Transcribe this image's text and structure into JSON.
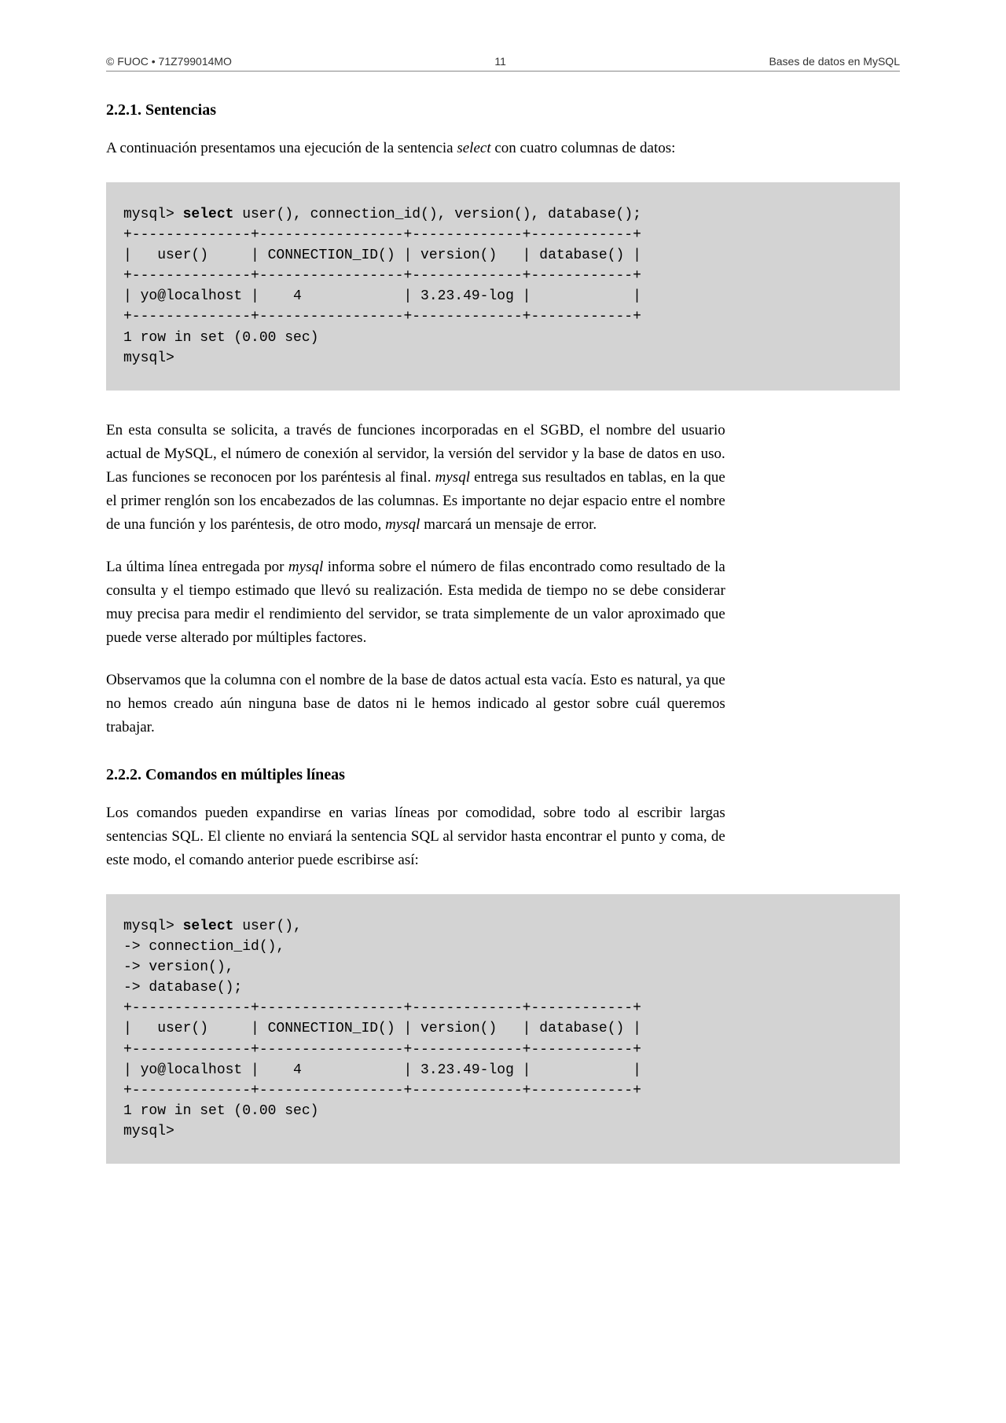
{
  "header": {
    "left": "© FUOC • 71Z799014MO",
    "center": "11",
    "right": "Bases de datos en MySQL"
  },
  "section1": {
    "number": "2.2.1.",
    "title": "Sentencias",
    "intro_before_italic": "A continuación presentamos una ejecución de la sentencia ",
    "intro_italic": "select",
    "intro_after_italic": " con cuatro columnas de datos:"
  },
  "code1": {
    "line1_prefix": "mysql> ",
    "line1_bold": "select",
    "line1_suffix": " user(), connection_id(), version(), database();",
    "line2": "+--------------+-----------------+-------------+------------+",
    "line3": "|   user()     | CONNECTION_ID() | version()   | database() |",
    "line4": "+--------------+-----------------+-------------+------------+",
    "line5": "| yo@localhost |    4            | 3.23.49-log |            |",
    "line6": "+--------------+-----------------+-------------+------------+",
    "line7": "1 row in set (0.00 sec)",
    "line8": "mysql>"
  },
  "para1": {
    "t1": "En esta consulta se solicita, a través de funciones incorporadas en el SGBD, el nombre del usuario actual de MySQL, el número de conexión al servidor, la versión del servidor y la base de datos en uso. Las funciones se reconocen por los paréntesis al final. ",
    "i1": "mysql",
    "t2": " entrega sus resultados en tablas, en la que el primer renglón son los encabezados de las columnas. Es importante no dejar espacio entre el nombre de una función y los paréntesis, de otro modo, ",
    "i2": "mysql",
    "t3": " marcará un mensaje de error."
  },
  "para2": {
    "t1": "La última línea entregada por ",
    "i1": "mysql",
    "t2": " informa sobre el número de filas encontrado como resultado de la consulta y el tiempo estimado que llevó su realización. Esta medida de tiempo no se debe considerar muy precisa para medir el rendimiento del servidor, se trata simplemente de un valor aproximado que puede verse alterado por múltiples factores."
  },
  "para3": {
    "t1": "Observamos que la columna con el nombre de la base de datos actual esta vacía. Esto es natural, ya que no hemos creado aún ninguna base de datos ni le hemos indicado al gestor sobre cuál queremos trabajar."
  },
  "section2": {
    "number": "2.2.2.",
    "title": "Comandos en múltiples líneas",
    "intro": "Los comandos pueden expandirse en varias líneas por comodidad, sobre todo al escribir largas sentencias SQL. El cliente no enviará la sentencia SQL al servidor hasta encontrar el punto y coma, de este modo, el comando anterior puede escribirse así:"
  },
  "code2": {
    "line1_prefix": "mysql> ",
    "line1_bold": "select",
    "line1_suffix": " user(),",
    "line2": "-> connection_id(),",
    "line3": "-> version(),",
    "line4": "-> database();",
    "line5": "+--------------+-----------------+-------------+------------+",
    "line6": "|   user()     | CONNECTION_ID() | version()   | database() |",
    "line7": "+--------------+-----------------+-------------+------------+",
    "line8": "| yo@localhost |    4            | 3.23.49-log |            |",
    "line9": "+--------------+-----------------+-------------+------------+",
    "line10": "1 row in set (0.00 sec)",
    "line11": "mysql>"
  }
}
